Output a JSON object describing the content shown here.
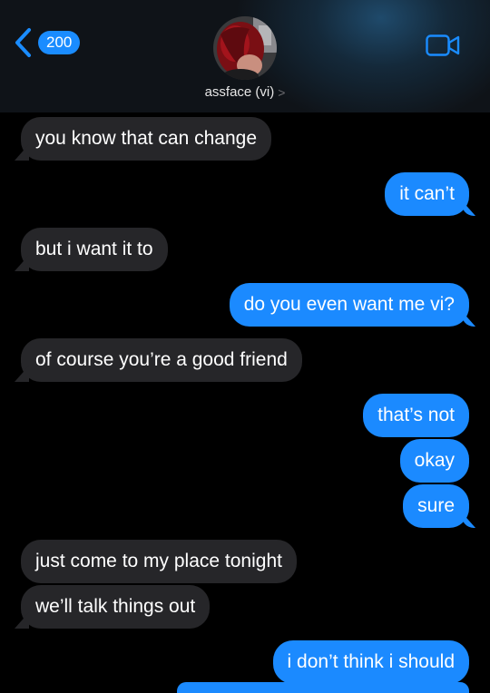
{
  "header": {
    "back_count": "200",
    "contact_name": "assface (vi)",
    "contact_chevron": ">",
    "back_icon": "chevron-left-icon",
    "video_icon": "video-camera-icon",
    "accent_color": "#1b8aff"
  },
  "messages": [
    {
      "from": "them",
      "text": "you know that can change"
    },
    {
      "from": "me",
      "text": "it can’t"
    },
    {
      "from": "them",
      "text": "but i want it to"
    },
    {
      "from": "me",
      "text": "do you even want me vi?"
    },
    {
      "from": "them",
      "text": "of course you’re a good friend"
    },
    {
      "from": "me",
      "text": "that’s not"
    },
    {
      "from": "me",
      "text": "okay"
    },
    {
      "from": "me",
      "text": "sure"
    },
    {
      "from": "them",
      "text": "just come to my place tonight"
    },
    {
      "from": "them",
      "text": "we’ll talk things out"
    },
    {
      "from": "me",
      "text": "i don’t think i should"
    }
  ],
  "colors": {
    "sent_bubble": "#1b8aff",
    "received_bubble": "#262629",
    "background": "#000000"
  }
}
